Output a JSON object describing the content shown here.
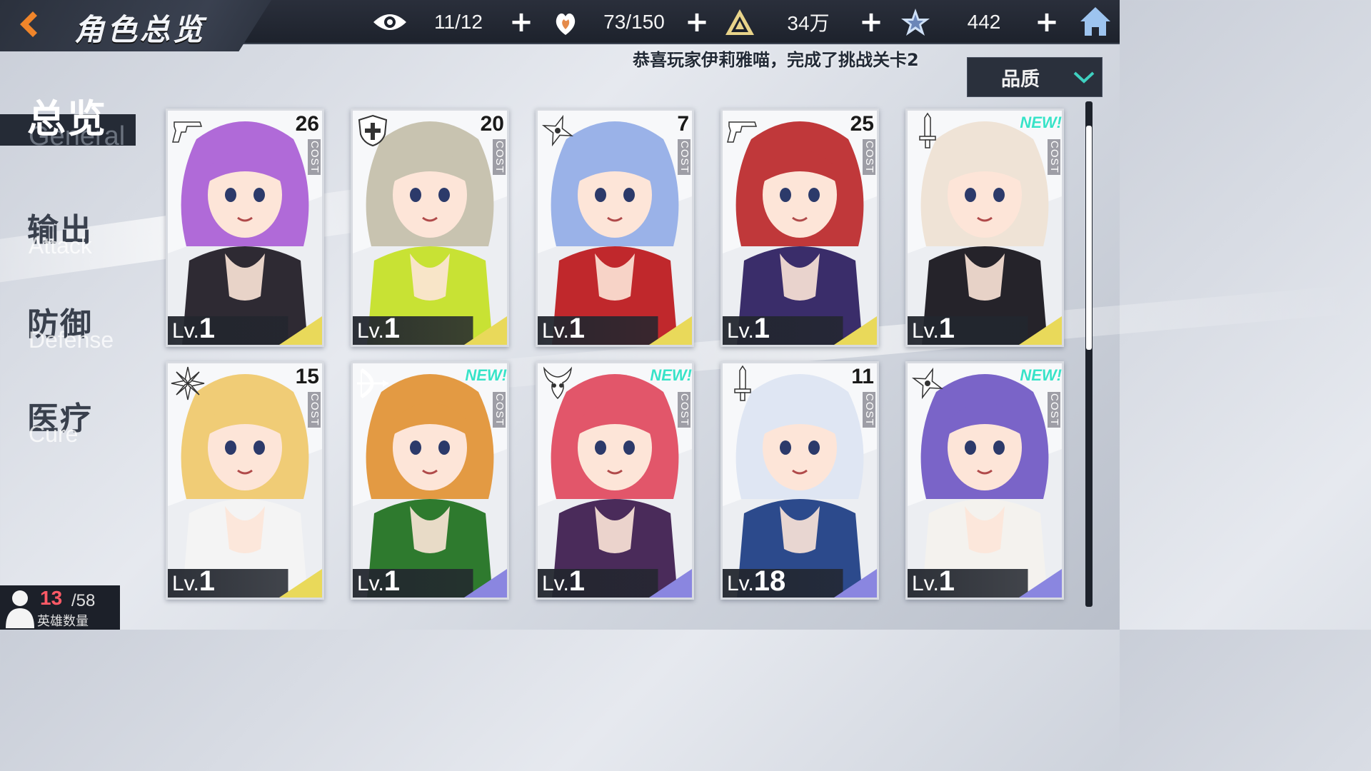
{
  "header": {
    "title": "角色总览",
    "back_icon": "back-arrow-icon",
    "home_icon": "home-icon"
  },
  "resources": [
    {
      "name": "vision",
      "icon": "eye-icon",
      "value": "11/12"
    },
    {
      "name": "stamina",
      "icon": "heart-flame-icon",
      "value": "73/150"
    },
    {
      "name": "currency",
      "icon": "triangle-emblem-icon",
      "value": "34万"
    },
    {
      "name": "gems",
      "icon": "star-crystal-icon",
      "value": "442"
    }
  ],
  "broadcast": "恭喜玩家伊莉雅喵，完成了挑战关卡2",
  "filter": {
    "label": "品质",
    "icon": "chevron-down-icon"
  },
  "sidebar": [
    {
      "cn": "总览",
      "en": "General",
      "active": true
    },
    {
      "cn": "输出",
      "en": "Attack",
      "active": false
    },
    {
      "cn": "防御",
      "en": "Defense",
      "active": false
    },
    {
      "cn": "医疗",
      "en": "Cure",
      "active": false
    }
  ],
  "hero_count": {
    "owned": "13",
    "total": "/58",
    "label": "英雄数量"
  },
  "level_prefix": "Lv.",
  "cost_label": "COST",
  "new_label": "NEW!",
  "cards": [
    {
      "cost": "26",
      "level": "1",
      "class_icon": "pistol-icon",
      "new": false,
      "hair": "#b06ad8",
      "outfit": "#2e2a33",
      "accent": "#e9d95a"
    },
    {
      "cost": "20",
      "level": "1",
      "class_icon": "shield-cross-icon",
      "new": false,
      "hair": "#c8c3b0",
      "outfit": "#c8e234",
      "accent": "#e9d95a"
    },
    {
      "cost": "7",
      "level": "1",
      "class_icon": "shuriken-icon",
      "new": false,
      "hair": "#9ab2e8",
      "outfit": "#c0282c",
      "accent": "#e9d95a"
    },
    {
      "cost": "25",
      "level": "1",
      "class_icon": "pistol-icon",
      "new": false,
      "hair": "#c0383a",
      "outfit": "#3a2d6a",
      "accent": "#e9d95a"
    },
    {
      "cost": "",
      "level": "1",
      "class_icon": "sword-icon",
      "new": true,
      "hair": "#efe3d6",
      "outfit": "#25232a",
      "accent": "#e9d95a"
    },
    {
      "cost": "15",
      "level": "1",
      "class_icon": "star-flower-icon",
      "new": false,
      "hair": "#f0cc76",
      "outfit": "#f4f4f4",
      "accent": "#e9d95a"
    },
    {
      "cost": "",
      "level": "1",
      "class_icon": "bow-icon",
      "new": true,
      "hair": "#e39a43",
      "outfit": "#2e7a2e",
      "accent": "#8a86e0"
    },
    {
      "cost": "",
      "level": "1",
      "class_icon": "demon-horn-icon",
      "new": true,
      "hair": "#e2566a",
      "outfit": "#4a2b5a",
      "accent": "#8a86e0"
    },
    {
      "cost": "11",
      "level": "18",
      "class_icon": "sword-icon",
      "new": false,
      "hair": "#dfe6f3",
      "outfit": "#2c4a8c",
      "accent": "#8a86e0"
    },
    {
      "cost": "",
      "level": "1",
      "class_icon": "shuriken-icon",
      "new": true,
      "hair": "#7a64c8",
      "outfit": "#f4f2ee",
      "accent": "#8a86e0"
    }
  ]
}
